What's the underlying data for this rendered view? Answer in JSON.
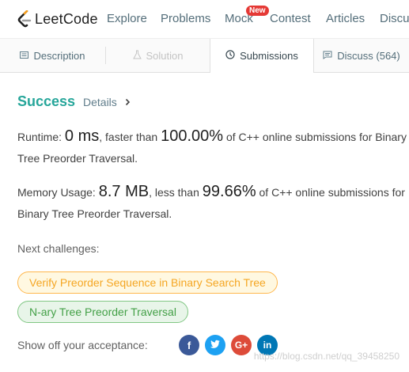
{
  "nav": {
    "logo": "LeetCode",
    "links": [
      "Explore",
      "Problems",
      "Mock",
      "Contest",
      "Articles",
      "Discuss"
    ],
    "badge": "New"
  },
  "tabs": [
    {
      "label": "Description",
      "icon": "document-icon",
      "state": "normal"
    },
    {
      "label": "Solution",
      "icon": "flask-icon",
      "state": "disabled"
    },
    {
      "label": "Submissions",
      "icon": "clock-icon",
      "state": "active"
    },
    {
      "label": "Discuss (564)",
      "icon": "chat-icon",
      "state": "normal"
    }
  ],
  "result": {
    "status": "Success",
    "details": "Details",
    "runtime": {
      "label": "Runtime:",
      "value": "0 ms",
      "mid": ", faster than",
      "percent": "100.00%",
      "tail": "of C++ online submissions for Binary",
      "line2": "Tree Preorder Traversal."
    },
    "memory": {
      "label": "Memory Usage:",
      "value": "8.7 MB",
      "mid": ", less than",
      "percent": "99.66%",
      "tail": "of C++ online submissions for",
      "line2": "Binary Tree Preorder Traversal."
    }
  },
  "challenges": {
    "label": "Next challenges:",
    "items": [
      {
        "label": "Verify Preorder Sequence in Binary Search Tree",
        "color": "#f5a623"
      },
      {
        "label": "N-ary Tree Preorder Traversal",
        "color": "#43a047"
      }
    ]
  },
  "share": {
    "label": "Show off your acceptance:",
    "buttons": [
      {
        "icon": "facebook-icon",
        "glyph": "f",
        "color": "#3b5998"
      },
      {
        "icon": "twitter-icon",
        "glyph": "t",
        "color": "#1da1f2"
      },
      {
        "icon": "google-plus-icon",
        "glyph": "G+",
        "color": "#dd4b39"
      },
      {
        "icon": "linkedin-icon",
        "glyph": "in",
        "color": "#0077b5"
      }
    ]
  },
  "watermark": "https://blog.csdn.net/qq_39458250",
  "colors": {
    "accent": "#26a69a",
    "orange": "#f5a623",
    "green": "#43a047",
    "badge": "#e53935"
  }
}
